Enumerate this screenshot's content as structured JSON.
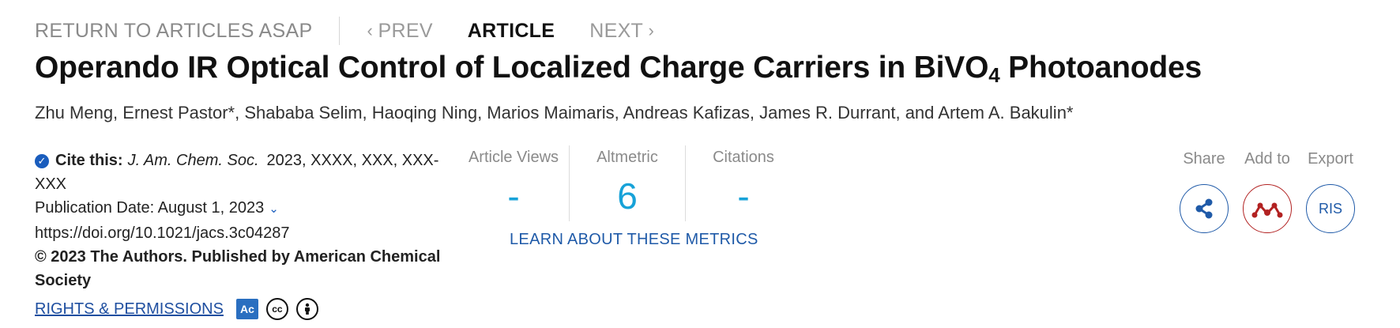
{
  "nav": {
    "return_label": "RETURN TO ARTICLES ASAP",
    "prev_label": "PREV",
    "current_label": "ARTICLE",
    "next_label": "NEXT"
  },
  "article": {
    "title_main": "Operando IR Optical Control of Localized Charge Carriers in BiVO",
    "title_sub": "4",
    "title_end": " Photoanodes",
    "authors": "Zhu Meng, Ernest Pastor*, Shababa Selim, Haoqing Ning, Marios Maimaris, Andreas Kafizas, James R. Durrant, and Artem A. Bakulin*"
  },
  "citation": {
    "label": "Cite this:",
    "journal": "J. Am. Chem. Soc.",
    "details": "2023, XXXX, XXX, XXX-XXX",
    "pub_date": "Publication Date: August 1, 2023",
    "doi": "https://doi.org/10.1021/jacs.3c04287",
    "copyright": "© 2023 The Authors. Published by American Chemical Society",
    "rights_label": "RIGHTS & PERMISSIONS",
    "license_ac": "Ac",
    "license_cc": "cc"
  },
  "metrics": {
    "views_label": "Article Views",
    "views_value": "-",
    "altmetric_label": "Altmetric",
    "altmetric_value": "6",
    "citations_label": "Citations",
    "citations_value": "-",
    "learn_label": "LEARN ABOUT THESE METRICS"
  },
  "actions": {
    "share_label": "Share",
    "add_label": "Add to",
    "export_label": "Export",
    "ris_label": "RIS"
  },
  "colors": {
    "accent_blue": "#1f5aa8",
    "metric_blue": "#17a2d8",
    "mendeley_red": "#b22222"
  }
}
